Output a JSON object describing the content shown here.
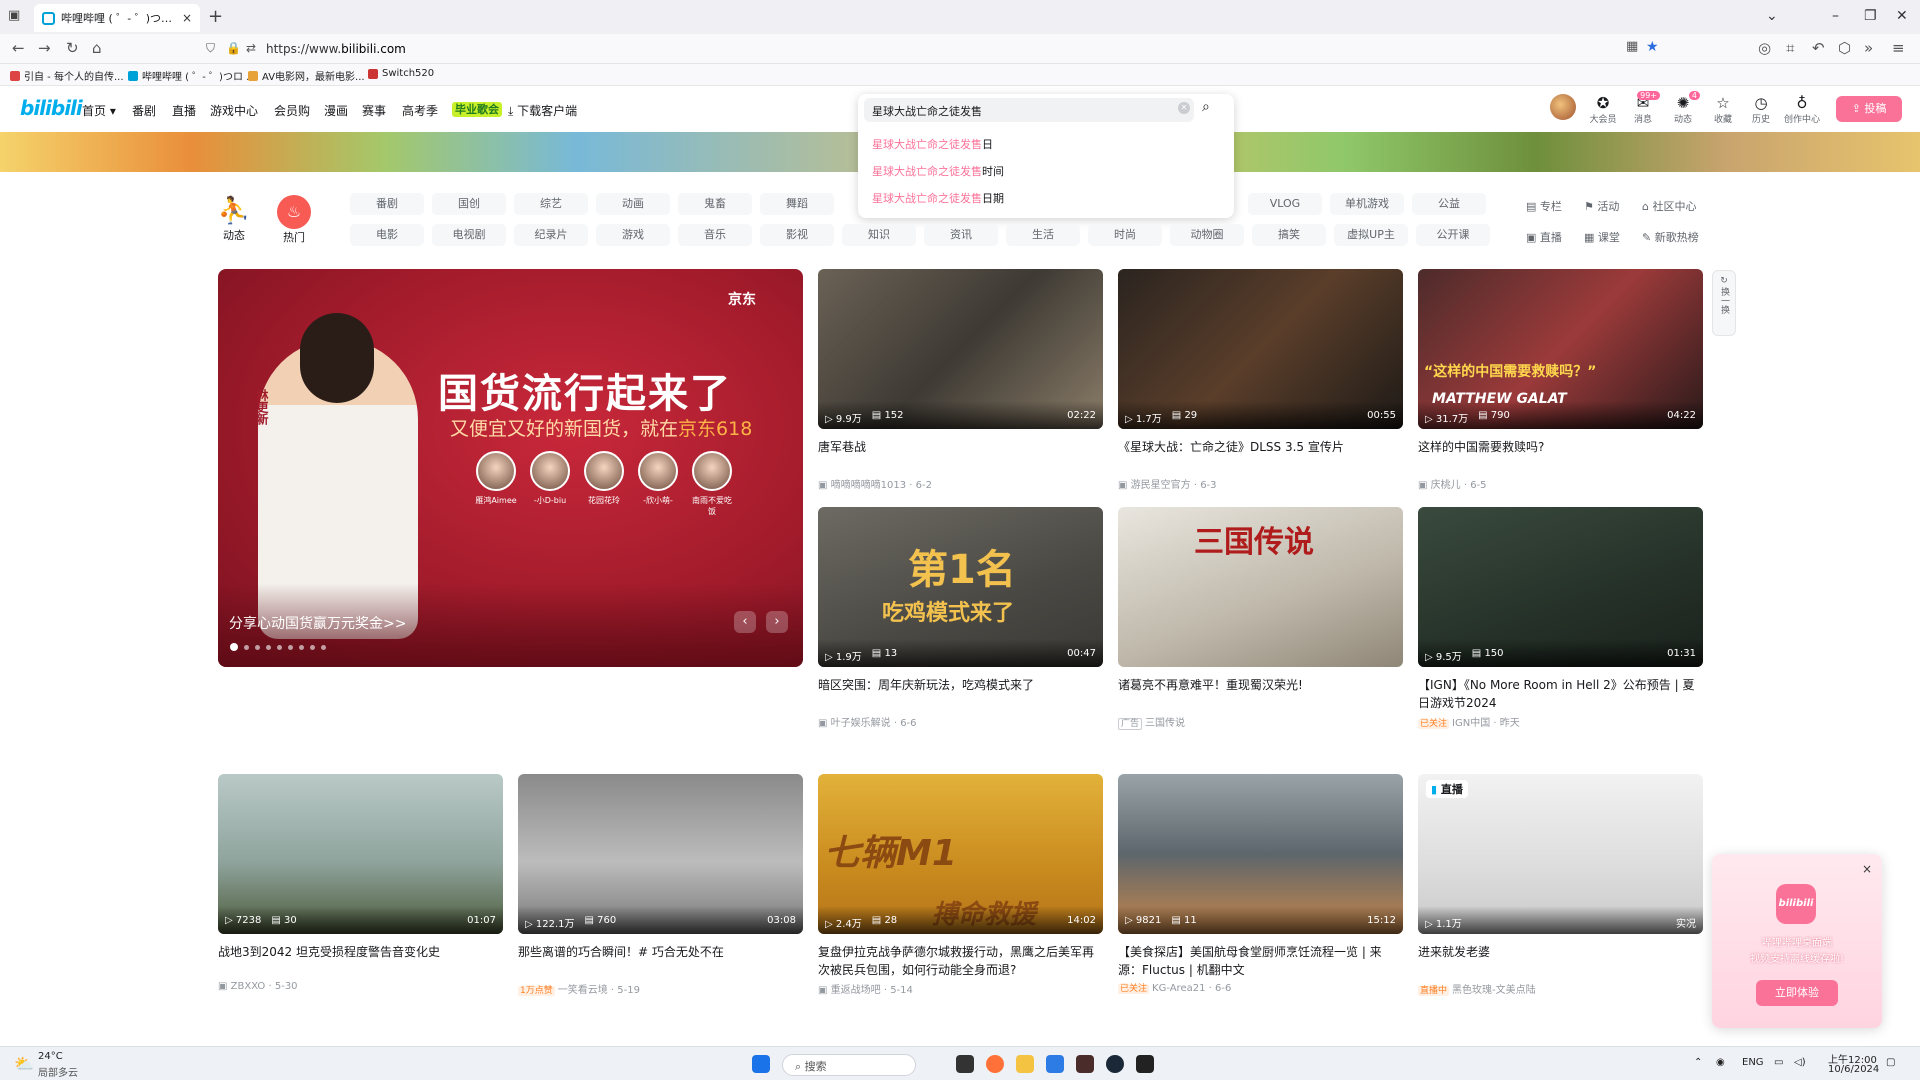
{
  "browser": {
    "tab_title": "哔哩哔哩 ( ゜- ゜)つロ 干杯~-bi",
    "tab_close": "×",
    "new_tab": "+",
    "url_prefix": "https://www.",
    "url_host": "bilibili.com",
    "bookmarks": [
      "引自 - 每个人的自传...",
      "哔哩哔哩 ( ゜- ゜)つロ ...",
      "AV电影网，最新电影...",
      "Switch520"
    ]
  },
  "header": {
    "logo": "bilibili",
    "nav": [
      "首页",
      "番剧",
      "直播",
      "游戏中心",
      "会员购",
      "漫画",
      "赛事",
      "高考季",
      "毕业歌会",
      "下载客户端"
    ],
    "right": [
      {
        "label": "大会员",
        "icon": "vip-icon"
      },
      {
        "label": "消息",
        "icon": "message-icon",
        "badge": "99+"
      },
      {
        "label": "动态",
        "icon": "dynamic-icon",
        "badge": "4"
      },
      {
        "label": "收藏",
        "icon": "favorite-icon"
      },
      {
        "label": "历史",
        "icon": "history-icon"
      },
      {
        "label": "创作中心",
        "icon": "creator-icon"
      }
    ],
    "upload": "投稿"
  },
  "search": {
    "value": "星球大战亡命之徒发售",
    "keyword": "星球大战亡命之徒发售",
    "suggestions": [
      {
        "suffix": "日"
      },
      {
        "suffix": "时间"
      },
      {
        "suffix": "日期"
      }
    ]
  },
  "channels": {
    "dynamic": "动态",
    "hot": "热门",
    "row1": [
      "番剧",
      "国创",
      "综艺",
      "动画",
      "鬼畜",
      "舞蹈",
      "VLOG",
      "单机游戏",
      "公益"
    ],
    "row2": [
      "电影",
      "电视剧",
      "纪录片",
      "游戏",
      "音乐",
      "影视",
      "知识",
      "资讯",
      "生活",
      "时尚",
      "动物圈",
      "搞笑",
      "虚拟UP主",
      "公开课"
    ],
    "side1": [
      "专栏",
      "活动",
      "社区中心"
    ],
    "side2": [
      "直播",
      "课堂",
      "新歌热榜"
    ]
  },
  "carousel": {
    "title": "国货流行起来了",
    "subtitle_prefix": "又便宜又好的新国货，就在",
    "subtitle_brand": "京东618",
    "brand": "京东",
    "vertical_name": "林更新",
    "faces": [
      "雁鸿Aimee",
      "-小D-biu",
      "花园花玲",
      "-欣小萌-",
      "南雨不爱吃饭"
    ],
    "caption": "分享心动国货赢万元奖金>>",
    "prev": "‹",
    "next": "›"
  },
  "refresh": "换一换",
  "videos": [
    {
      "views": "9.9万",
      "danmaku": "152",
      "duration": "02:22",
      "title": "唐军巷战",
      "author": "嘀嘀嘀嘀嘀1013",
      "date": "6-2"
    },
    {
      "views": "1.7万",
      "danmaku": "29",
      "duration": "00:55",
      "title": "《星球大战：亡命之徒》DLSS 3.5 宣传片",
      "author": "游民星空官方",
      "date": "6-3"
    },
    {
      "views": "31.7万",
      "danmaku": "790",
      "duration": "04:22",
      "title": "这样的中国需要救赎吗?",
      "author": "庆桃儿",
      "date": "6-5",
      "overlay": "“这样的中国需要救赎吗？”",
      "overlay2": "MATTHEW GALAT"
    },
    {
      "views": "1.9万",
      "danmaku": "13",
      "duration": "00:47",
      "title": "暗区突围：周年庆新玩法，吃鸡模式来了",
      "author": "叶子娱乐解说",
      "date": "6-6",
      "overlay": "第1名",
      "overlay2": "吃鸡模式来了"
    },
    {
      "views": "",
      "danmaku": "",
      "duration": "",
      "title": "诸葛亮不再意难平！重现蜀汉荣光!",
      "author": "三国传说",
      "date": "",
      "tag": "广告",
      "overlay": "三国传说"
    },
    {
      "views": "9.5万",
      "danmaku": "150",
      "duration": "01:31",
      "title": "【IGN】《No More Room in Hell 2》公布预告 | 夏日游戏节2024",
      "author": "IGN中国",
      "date": "昨天",
      "tag": "已关注"
    },
    {
      "views": "7238",
      "danmaku": "30",
      "duration": "01:07",
      "title": "战地3到2042 坦克受损程度警告音变化史",
      "author": "ZBXXO",
      "date": "5-30"
    },
    {
      "views": "122.1万",
      "danmaku": "760",
      "duration": "03:08",
      "title": "那些离谱的巧合瞬间！# 巧合无处不在",
      "author": "一笑看云境",
      "date": "5-19",
      "tag": "1万点赞"
    },
    {
      "views": "2.4万",
      "danmaku": "28",
      "duration": "14:02",
      "title": "复盘伊拉克战争萨德尔城救援行动，黑鹰之后美军再次被民兵包围，如何行动能全身而退?",
      "author": "重返战场吧",
      "date": "5-14",
      "overlay": "七辆M1",
      "overlay2": "搏命救援"
    },
    {
      "views": "9821",
      "danmaku": "11",
      "duration": "15:12",
      "title": "【美食探店】美国航母食堂厨师烹饪流程一览 | 来源：Fluctus | 机翻中文",
      "author": "KG-Area21",
      "date": "6-6",
      "tag": "已关注"
    },
    {
      "views": "1.1万",
      "danmaku": "",
      "duration": "实况",
      "title": "进来就发老婆",
      "author": "黑色玫瑰-文美点陆",
      "date": "",
      "tag": "直播中",
      "live": "直播"
    }
  ],
  "promo": {
    "logo": "bilibili",
    "line1": "哔哩哔哩桌面端",
    "line2": "视频支持离线缓存啦!",
    "button": "立即体验",
    "close": "×"
  },
  "taskbar": {
    "weather_temp": "24°C",
    "weather_desc": "局部多云",
    "search_placeholder": "搜索",
    "lang": "ENG",
    "time": "上午12:00",
    "date": "10/6/2024"
  },
  "colors": {
    "accent": "#fb7299",
    "brand_blue": "#00aeec"
  }
}
